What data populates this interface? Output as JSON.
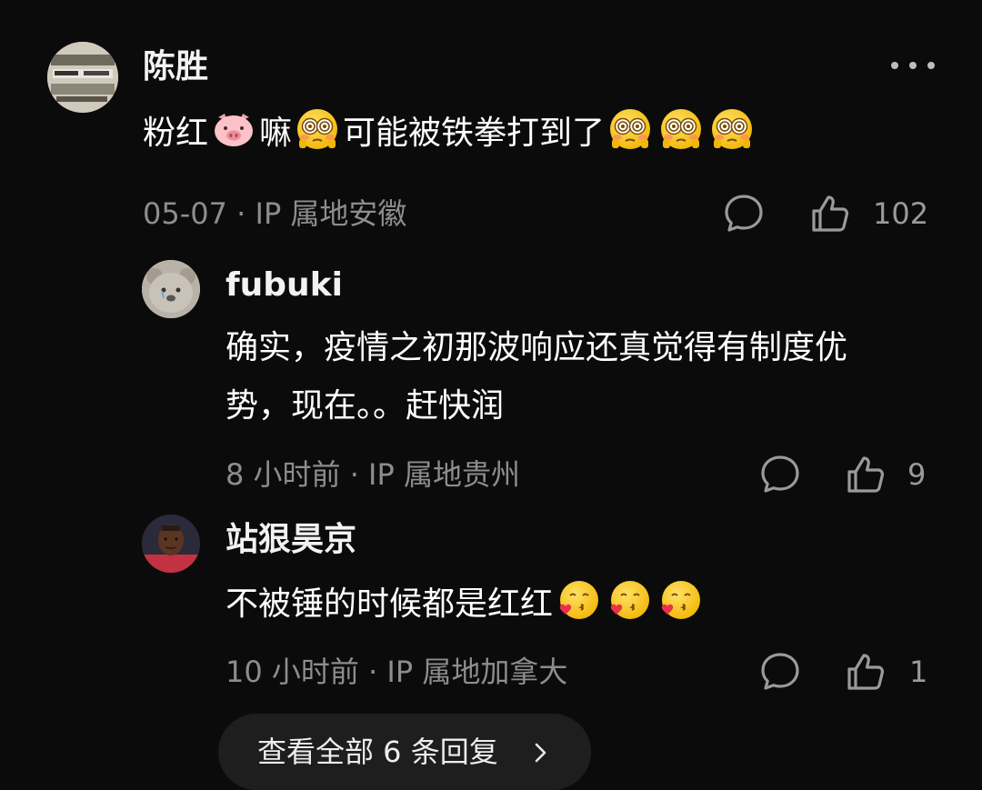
{
  "comment": {
    "author": "陈胜",
    "text_parts": [
      "粉红",
      "嘛",
      "可能被铁拳打到了"
    ],
    "emoji_pig": "pig-face-emoji",
    "emoji_flushed": "flushed-face-emoji",
    "meta": "05-07 · IP 属地安徽",
    "like_count": "102",
    "replies": [
      {
        "author": "fubuki",
        "text_line1": "确实，疫情之初那波响应还真觉得有制度优",
        "text_line2": "势，现在。。赶快润",
        "meta": "8 小时前 · IP 属地贵州",
        "like_count": "9"
      },
      {
        "author": "站狠昊京",
        "text": "不被锤的时候都是红红",
        "emoji_kiss": "face-blowing-kiss-emoji",
        "meta": "10 小时前 · IP 属地加拿大",
        "like_count": "1"
      }
    ],
    "view_all_label": "查看全部 6 条回复"
  },
  "colors": {
    "background": "#0b0b0b",
    "text_primary": "#ffffff",
    "text_secondary": "#8d8d8d",
    "pill_bg": "#1e1e1e",
    "emoji_yellow": "#f7c21a"
  }
}
